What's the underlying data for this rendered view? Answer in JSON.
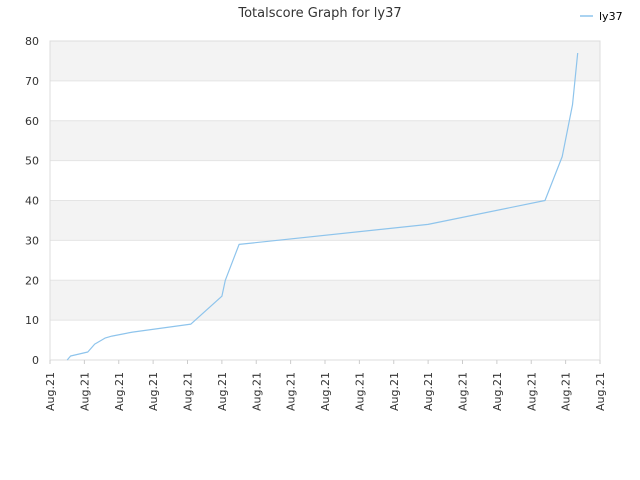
{
  "chart_data": {
    "type": "line",
    "title": "Totalscore Graph for ly37",
    "xlabel": "",
    "ylabel": "",
    "ylim": [
      0,
      80
    ],
    "y_ticks": [
      0,
      10,
      20,
      30,
      40,
      50,
      60,
      70,
      80
    ],
    "x_tick_labels": [
      "Aug.21",
      "Aug.21",
      "Aug.21",
      "Aug.21",
      "Aug.21",
      "Aug.21",
      "Aug.21",
      "Aug.21",
      "Aug.21",
      "Aug.21",
      "Aug.21",
      "Aug.21",
      "Aug.21",
      "Aug.21",
      "Aug.21",
      "Aug.21",
      "Aug.21"
    ],
    "x_range": [
      0,
      16
    ],
    "grid": "horizontal alternating bands",
    "legend_position": "top-right",
    "series": [
      {
        "name": "ly37",
        "color": "#8ec4ec",
        "x": [
          0.5,
          0.6,
          1.1,
          1.3,
          1.5,
          1.6,
          1.8,
          2.1,
          2.4,
          4.1,
          5.0,
          5.1,
          5.5,
          11.0,
          14.4,
          14.9,
          15.2,
          15.35
        ],
        "y": [
          0,
          1,
          2,
          4,
          5,
          5.5,
          6,
          6.5,
          7,
          9,
          16,
          20,
          29,
          34,
          40,
          51,
          64,
          77
        ]
      }
    ]
  }
}
